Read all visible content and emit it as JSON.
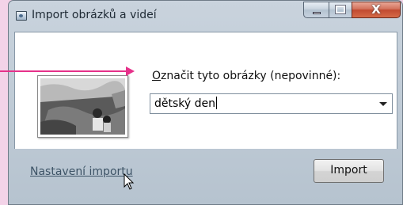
{
  "window": {
    "title": "Import obrázků a videí",
    "close_label": "X"
  },
  "dialog": {
    "tag_label_mnemonic": "O",
    "tag_label_rest": "značit tyto obrázky (nepovinné):",
    "tag_input_value": "dětský den",
    "settings_link": "Nastavení importu",
    "import_button": "Import"
  },
  "colors": {
    "annotation_arrow": "#e6318a",
    "background": "#f3d3e8",
    "close_button": "#c14a30"
  }
}
